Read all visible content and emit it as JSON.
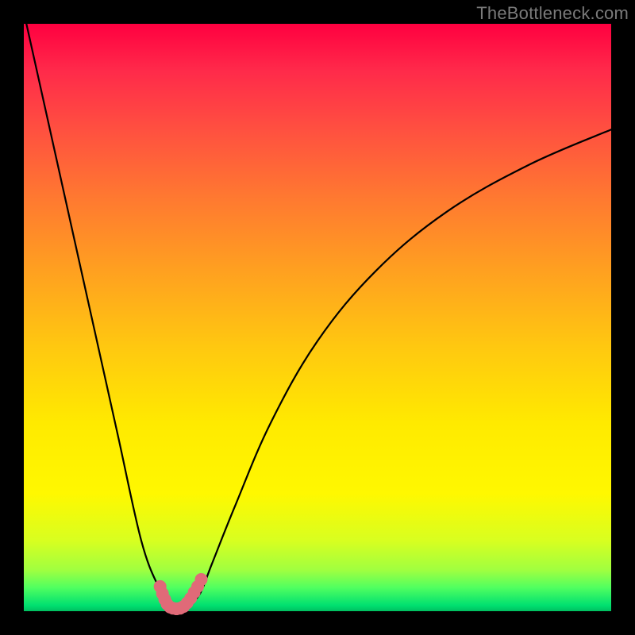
{
  "watermark": "TheBottleneck.com",
  "colors": {
    "curve_stroke": "#000000",
    "marker_stroke": "#e06a78",
    "marker_fill": "#e06a78"
  },
  "chart_data": {
    "type": "line",
    "title": "",
    "xlabel": "",
    "ylabel": "",
    "xlim": [
      0,
      100
    ],
    "ylim": [
      0,
      100
    ],
    "grid": false,
    "legend": false,
    "series": [
      {
        "name": "bottleneck-curve",
        "x": [
          0,
          4,
          8,
          12,
          16,
          20,
          23,
          25,
          26,
          27,
          28,
          30,
          32,
          36,
          42,
          50,
          60,
          72,
          86,
          100
        ],
        "y": [
          102,
          84,
          66,
          48,
          30,
          12,
          4,
          1,
          0.5,
          0.5,
          1,
          3,
          8,
          18,
          32,
          46,
          58,
          68,
          76,
          82
        ]
      }
    ],
    "markers": {
      "name": "optimal-zone",
      "x": [
        23.2,
        23.6,
        24.0,
        24.4,
        24.9,
        25.4,
        26.0,
        26.6,
        27.2,
        27.8,
        28.4,
        29.0,
        29.6,
        30.2
      ],
      "y": [
        4.2,
        3.0,
        2.0,
        1.2,
        0.7,
        0.5,
        0.4,
        0.5,
        0.8,
        1.4,
        2.2,
        3.2,
        4.2,
        5.4
      ]
    }
  }
}
